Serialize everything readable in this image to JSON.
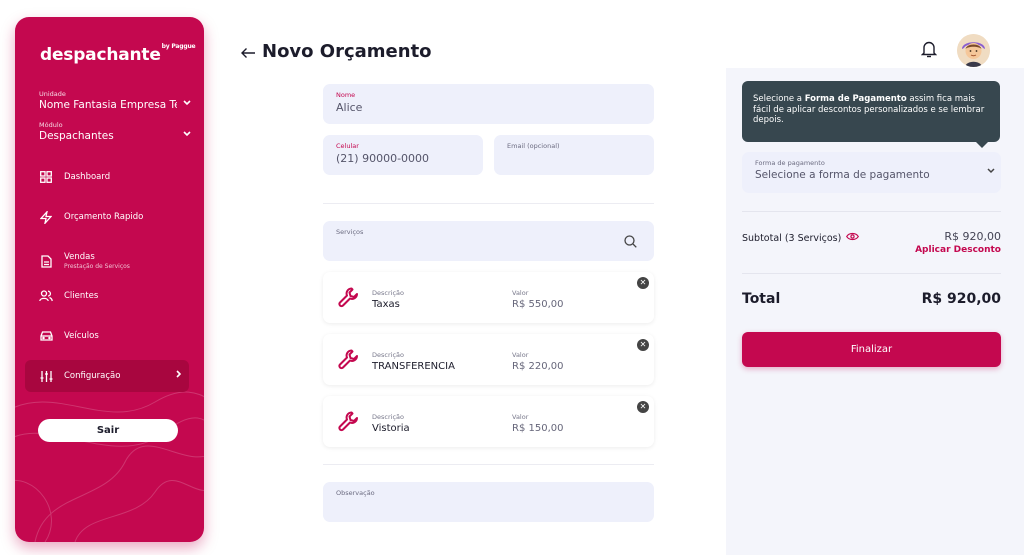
{
  "sidebar": {
    "brand": "despachante",
    "brand_suffix": "by Paggue",
    "unit": {
      "label": "Unidade",
      "value": "Nome Fantasia Empresa Teste"
    },
    "module": {
      "label": "Módulo",
      "value": "Despachantes"
    },
    "items": [
      {
        "label": "Dashboard",
        "icon": "dashboard-icon"
      },
      {
        "label": "Orçamento Rapido",
        "icon": "lightning-icon"
      },
      {
        "label": "Vendas",
        "sub": "Prestação de Serviços",
        "icon": "document-icon"
      },
      {
        "label": "Clientes",
        "icon": "users-icon"
      },
      {
        "label": "Veículos",
        "icon": "car-icon"
      },
      {
        "label": "Configuração",
        "icon": "sliders-icon",
        "active": true
      }
    ],
    "logout_label": "Sair"
  },
  "header": {
    "back_icon": "arrow-left-icon",
    "title": "Novo Orçamento",
    "bell_icon": "bell-icon"
  },
  "form": {
    "name": {
      "label": "Nome",
      "value": "Alice"
    },
    "phone": {
      "label": "Celular",
      "value": "(21) 90000-0000"
    },
    "email": {
      "label": "Email (opcional)",
      "value": ""
    },
    "services": {
      "label": "Serviços",
      "search_icon": "search-icon"
    },
    "service_items": [
      {
        "desc_label": "Descrição",
        "desc": "Taxas",
        "value_label": "Valor",
        "value": "R$ 550,00"
      },
      {
        "desc_label": "Descrição",
        "desc": "TRANSFERENCIA",
        "value_label": "Valor",
        "value": "R$ 220,00"
      },
      {
        "desc_label": "Descrição",
        "desc": "Vistoria",
        "value_label": "Valor",
        "value": "R$ 150,00"
      }
    ],
    "remove_glyph": "✕",
    "notes": {
      "label": "Observação",
      "value": ""
    }
  },
  "summary": {
    "tooltip": {
      "prefix": "Selecione a ",
      "bold": "Forma de Pagamento",
      "suffix": " assim fica mais fácil de aplicar descontos personalizados e se lembrar depois."
    },
    "payment": {
      "label": "Forma de pagamento",
      "placeholder": "Selecione a forma de pagamento"
    },
    "subtotal_label": "Subtotal (3 Serviços)",
    "subtotal_value": "R$ 920,00",
    "discount_label": "Aplicar Desconto",
    "total_label": "Total",
    "total_value": "R$ 920,00",
    "finalize_label": "Finalizar"
  },
  "colors": {
    "brand": "#c4084f",
    "tooltip": "#37474f",
    "field_bg": "#eef0fb",
    "panel_bg": "#f4f5fb"
  }
}
